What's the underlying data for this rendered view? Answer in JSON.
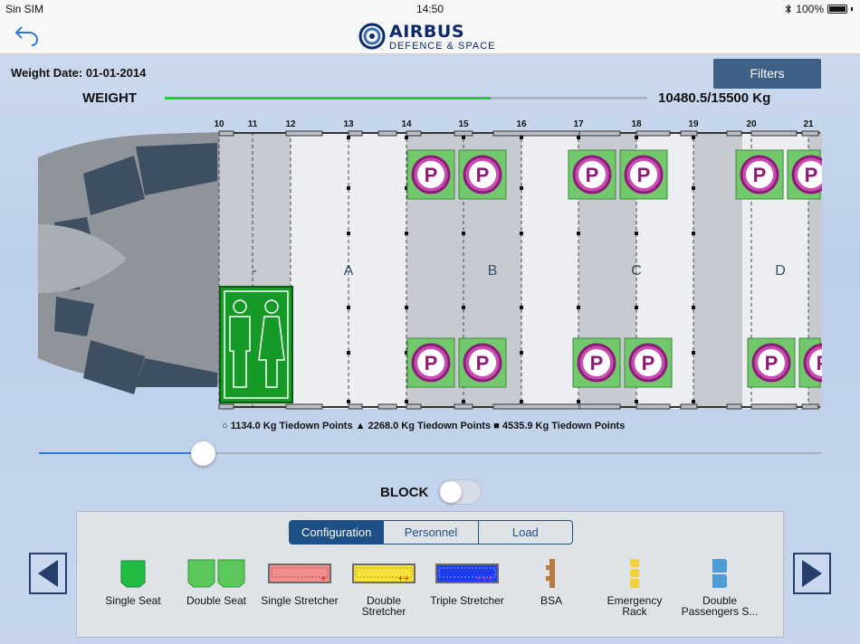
{
  "status_bar": {
    "carrier": "Sin SIM",
    "time": "14:50",
    "battery": "100%"
  },
  "logo": {
    "brand": "AIRBUS",
    "sub": "DEFENCE & SPACE"
  },
  "weight_date": "Weight Date: 01-01-2014",
  "filters_label": "Filters",
  "weight": {
    "label": "WEIGHT",
    "value": "10480.5/15500 Kg",
    "fraction": 0.676
  },
  "frames": [
    "10",
    "11",
    "12",
    "13",
    "14",
    "15",
    "16",
    "17",
    "18",
    "19",
    "20",
    "21"
  ],
  "zones": [
    "-",
    "A",
    "B",
    "C",
    "D"
  ],
  "tiedown_legend": "○ 1134.0 Kg Tiedown Points ▲ 2268.0 Kg Tiedown Points ■ 4535.9 Kg Tiedown Points",
  "position_slider_fraction": 0.21,
  "block_label": "BLOCK",
  "block_on": false,
  "tabs": [
    {
      "label": "Configuration",
      "active": true
    },
    {
      "label": "Personnel",
      "active": false
    },
    {
      "label": "Load",
      "active": false
    }
  ],
  "items": [
    {
      "label": "Single Seat",
      "icon": "single-seat-icon"
    },
    {
      "label": "Double Seat",
      "icon": "double-seat-icon"
    },
    {
      "label": "Single Stretcher",
      "icon": "single-stretcher-icon"
    },
    {
      "label": "Double\nStretcher",
      "icon": "double-stretcher-icon"
    },
    {
      "label": "Triple Stretcher",
      "icon": "triple-stretcher-icon"
    },
    {
      "label": "BSA",
      "icon": "bsa-icon"
    },
    {
      "label": "Emergency\nRack",
      "icon": "emergency-rack-icon"
    },
    {
      "label": "Double\nPassengers S...",
      "icon": "double-passenger-seat-icon"
    }
  ],
  "parking_marker": "P",
  "colors": {
    "accent": "#1e4f86",
    "weight_bar": "#1fd12d",
    "slider": "#2f78d8",
    "toilet": "#169a27",
    "parking_bg": "#72c96b",
    "parking_ring": "#8e1a7a"
  }
}
